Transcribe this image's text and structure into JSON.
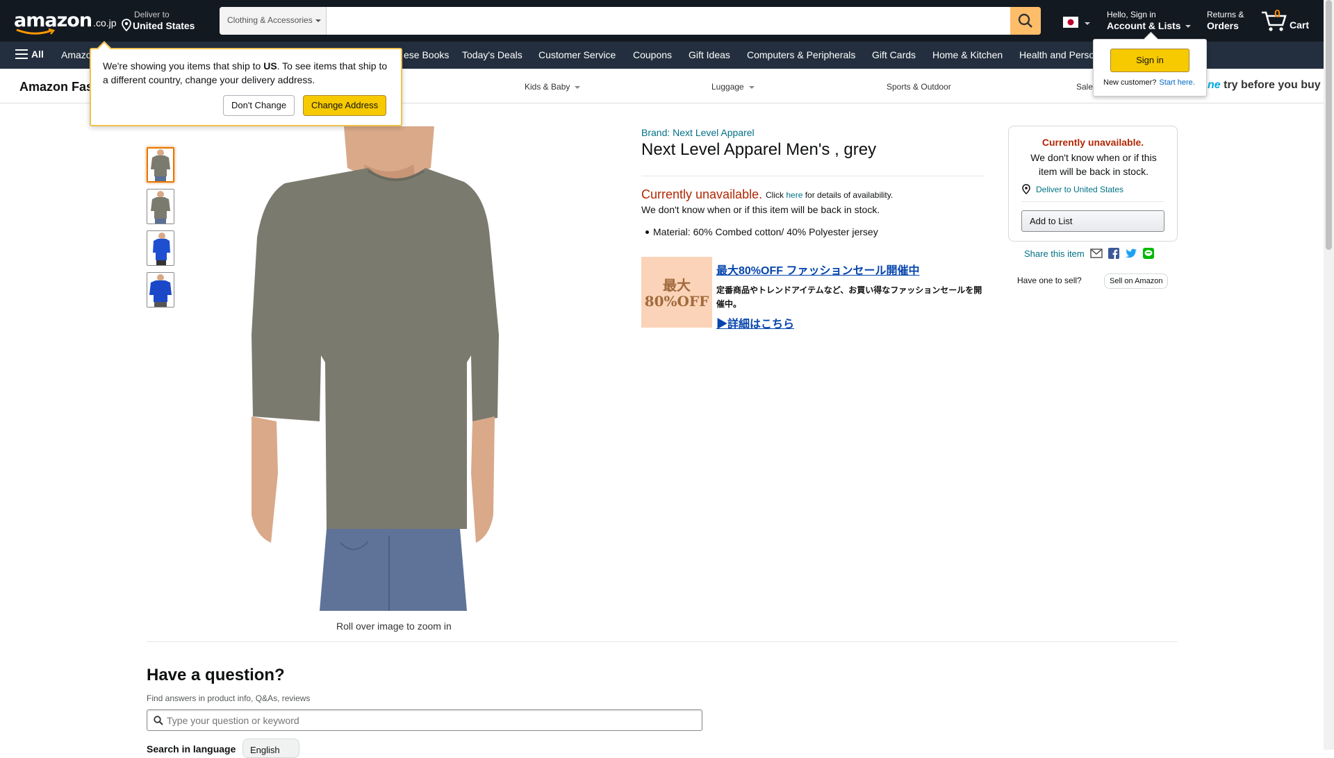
{
  "nav": {
    "logo_text": "amazon",
    "logo_tld": ".co.jp",
    "deliver_line1": "Deliver to",
    "deliver_line2": "United States",
    "search_category": "Clothing & Accessories",
    "search_placeholder": "",
    "account_line1": "Hello, Sign in",
    "account_line2": "Account & Lists",
    "returns_line1": "Returns &",
    "returns_line2": "Orders",
    "cart_count": "0",
    "cart_label": "Cart"
  },
  "subnav": {
    "all_label": "All",
    "items": [
      "Amazon",
      "ese Books",
      "Today's Deals",
      "Customer Service",
      "Coupons",
      "Gift Ideas",
      "Computers & Peripherals",
      "Gift Cards",
      "Home & Kitchen",
      "Health and Perso"
    ]
  },
  "store": {
    "title": "Amazon Fas",
    "items": [
      "Kids & Baby",
      "Luggage",
      "Sports & Outdoor",
      "Sale"
    ],
    "tbyb_prefix": "ne",
    "tbyb_text": "try before you buy"
  },
  "popover": {
    "text_pre": "We're showing you items that ship to ",
    "text_country": "US",
    "text_post": ". To see items that ship to a different country, change your delivery address.",
    "dont_change": "Don't Change",
    "change_address": "Change Address"
  },
  "signin_flyout": {
    "button": "Sign in",
    "new_customer": "New customer?",
    "start_here": "Start here."
  },
  "product": {
    "brand": "Brand: Next Level Apparel",
    "title": "Next Level Apparel Men's , grey",
    "unavailable": "Currently unavailable.",
    "click_pre": "Click ",
    "click_here": "here",
    "click_post": " for details of availability.",
    "dont_know": "We don't know when or if this item will be back in stock.",
    "bullet": "Material: 60% Combed cotton/ 40% Polyester jersey",
    "roll_over": "Roll over image to zoom in",
    "thumb_colors": [
      "#7a7a6e",
      "#7a7a6e",
      "#1e4fd0",
      "#1a48c8"
    ]
  },
  "promo": {
    "img_line1": "最大",
    "img_line2": "80%OFF",
    "title": "最大80%OFF ファッションセール開催中",
    "body": "定番商品やトレンドアイテムなど、お買い得なファッションセールを開催中。",
    "link": "▶詳細はこちら"
  },
  "buybox": {
    "unavailable": "Currently unavailable.",
    "text": "We don't know when or if this item will be back in stock.",
    "deliver": "Deliver to United States",
    "add_to_list": "Add to List",
    "share": "Share this item",
    "have_one": "Have one to sell?",
    "sell_on_amazon": "Sell on Amazon"
  },
  "question": {
    "title": "Have a question?",
    "subtitle": "Find answers in product info, Q&As, reviews",
    "placeholder": "Type your question or keyword",
    "lang_label": "Search in language",
    "lang_value": "English"
  },
  "colors": {
    "nav_bg": "#131921",
    "subnav_bg": "#232f3e",
    "search_btn": "#febd69",
    "accent_yellow": "#f7ca00",
    "unavailable_red": "#b12704",
    "link_teal": "#007185"
  }
}
